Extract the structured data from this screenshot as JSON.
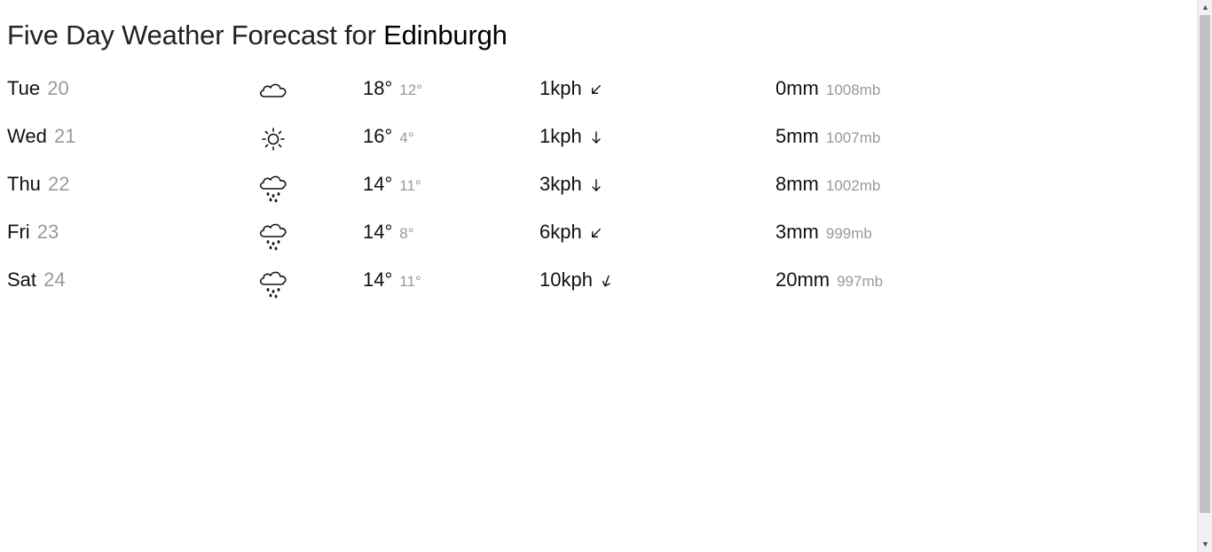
{
  "header": {
    "title_prefix": "Five Day Weather Forecast for",
    "city": "Edinburgh"
  },
  "forecast": [
    {
      "day": "Tue",
      "date": "20",
      "icon": "cloud-icon",
      "high": "18°",
      "low": "12°",
      "wind": "1kph",
      "wind_dir": "south-west",
      "rain": "0mm",
      "pressure": "1008mb"
    },
    {
      "day": "Wed",
      "date": "21",
      "icon": "sun-icon",
      "high": "16°",
      "low": "4°",
      "wind": "1kph",
      "wind_dir": "south",
      "rain": "5mm",
      "pressure": "1007mb"
    },
    {
      "day": "Thu",
      "date": "22",
      "icon": "rain-cloud-icon",
      "high": "14°",
      "low": "11°",
      "wind": "3kph",
      "wind_dir": "south",
      "rain": "8mm",
      "pressure": "1002mb"
    },
    {
      "day": "Fri",
      "date": "23",
      "icon": "rain-cloud-icon",
      "high": "14°",
      "low": "8°",
      "wind": "6kph",
      "wind_dir": "south-west",
      "rain": "3mm",
      "pressure": "999mb"
    },
    {
      "day": "Sat",
      "date": "24",
      "icon": "rain-cloud-icon",
      "high": "14°",
      "low": "11°",
      "wind": "10kph",
      "wind_dir": "south-south-west",
      "rain": "20mm",
      "pressure": "997mb"
    }
  ],
  "colors": {
    "primary_text": "#111111",
    "muted_text": "#999999"
  },
  "scrollbar": {
    "up_icon": "scroll-up-arrow-icon",
    "down_icon": "scroll-down-arrow-icon"
  }
}
